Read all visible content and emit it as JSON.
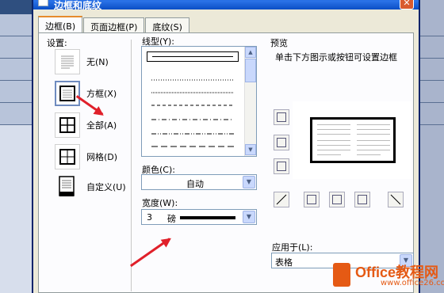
{
  "dialog": {
    "title": "边框和底纹",
    "close_glyph": "✕",
    "tabs": [
      "边框(B)",
      "页面边框(P)",
      "底纹(S)"
    ]
  },
  "settings": {
    "label": "设置:",
    "items": [
      {
        "label": "无(N)",
        "icon": "none-border-icon"
      },
      {
        "label": "方框(X)",
        "icon": "box-border-icon"
      },
      {
        "label": "全部(A)",
        "icon": "all-borders-icon"
      },
      {
        "label": "网格(D)",
        "icon": "grid-border-icon"
      },
      {
        "label": "自定义(U)",
        "icon": "custom-border-icon"
      }
    ],
    "selected": "方框(X)"
  },
  "line_style": {
    "label": "线型(Y):",
    "styles": [
      "solid",
      "dotted",
      "dotted-fine",
      "dashed",
      "dash-dot",
      "dash-dot-dot",
      "long-dash",
      "dotted-sparse"
    ],
    "selected": "solid"
  },
  "color": {
    "label": "颜色(C):",
    "value": "自动"
  },
  "width": {
    "label": "宽度(W):",
    "value": "3",
    "unit": "磅"
  },
  "preview": {
    "label": "预览",
    "hint": "单击下方图示或按钮可设置边框"
  },
  "apply_to": {
    "label": "应用于(L):",
    "value": "表格"
  },
  "watermark": {
    "brand": "Office教程网",
    "url": "www.office26.com"
  },
  "colors": {
    "accent": "#e0202a",
    "title_bar": "#0a5ad6",
    "brand": "#e55a14"
  }
}
